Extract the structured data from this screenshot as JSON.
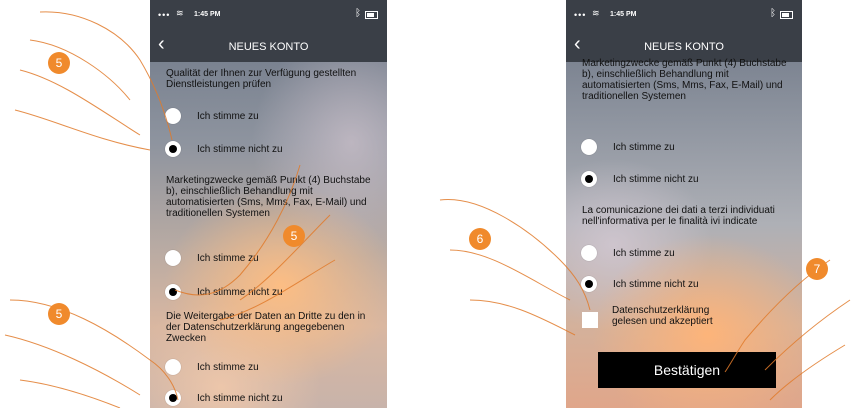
{
  "screens": [
    {
      "status": {
        "time": "1:45 PM"
      },
      "nav": {
        "back_icon": "chevron-left-icon",
        "title": "NEUES KONTO"
      },
      "paragraphs": [
        "Qualität der Ihnen zur Verfügung gestellten Dienstleistungen prüfen",
        "Marketingzwecke gemäß Punkt (4) Buchstabe b), einschließlich Behandlung mit automatisierten (Sms, Mms, Fax, E-Mail) und traditionellen Systemen",
        "Die Weitergabe der Daten an Dritte zu den in der Datenschutzerklärung angegebenen Zwecken"
      ],
      "options": [
        {
          "label": "Ich stimme zu",
          "selected": false
        },
        {
          "label": "Ich stimme nicht zu",
          "selected": true
        },
        {
          "label": "Ich stimme zu",
          "selected": false
        },
        {
          "label": "Ich stimme nicht zu",
          "selected": true
        },
        {
          "label": "Ich stimme zu",
          "selected": false
        },
        {
          "label": "Ich stimme nicht zu",
          "selected": true
        }
      ]
    },
    {
      "status": {
        "time": "1:45 PM"
      },
      "nav": {
        "back_icon": "chevron-left-icon",
        "title": "NEUES KONTO"
      },
      "paragraphs": [
        "Marketingzwecke gemäß Punkt (4) Buchstabe b), einschließlich Behandlung mit automatisierten (Sms, Mms, Fax, E-Mail) und traditionellen Systemen",
        "La comunicazione dei dati a terzi individuati nell'informativa per le finalità ivi indicate"
      ],
      "options": [
        {
          "label": "Ich stimme zu",
          "selected": false
        },
        {
          "label": "Ich stimme nicht zu",
          "selected": true
        },
        {
          "label": "Ich stimme zu",
          "selected": false
        },
        {
          "label": "Ich stimme nicht zu",
          "selected": true
        }
      ],
      "checkbox_label": "Datenschutzerklärung gelesen und akzeptiert",
      "confirm_label": "Bestätigen"
    }
  ],
  "step_badges": [
    "5",
    "5",
    "5",
    "6",
    "7"
  ],
  "colors": {
    "badge": "#f08a2c",
    "hand_stroke": "#e07a2a",
    "bar": "#3a3f47"
  }
}
